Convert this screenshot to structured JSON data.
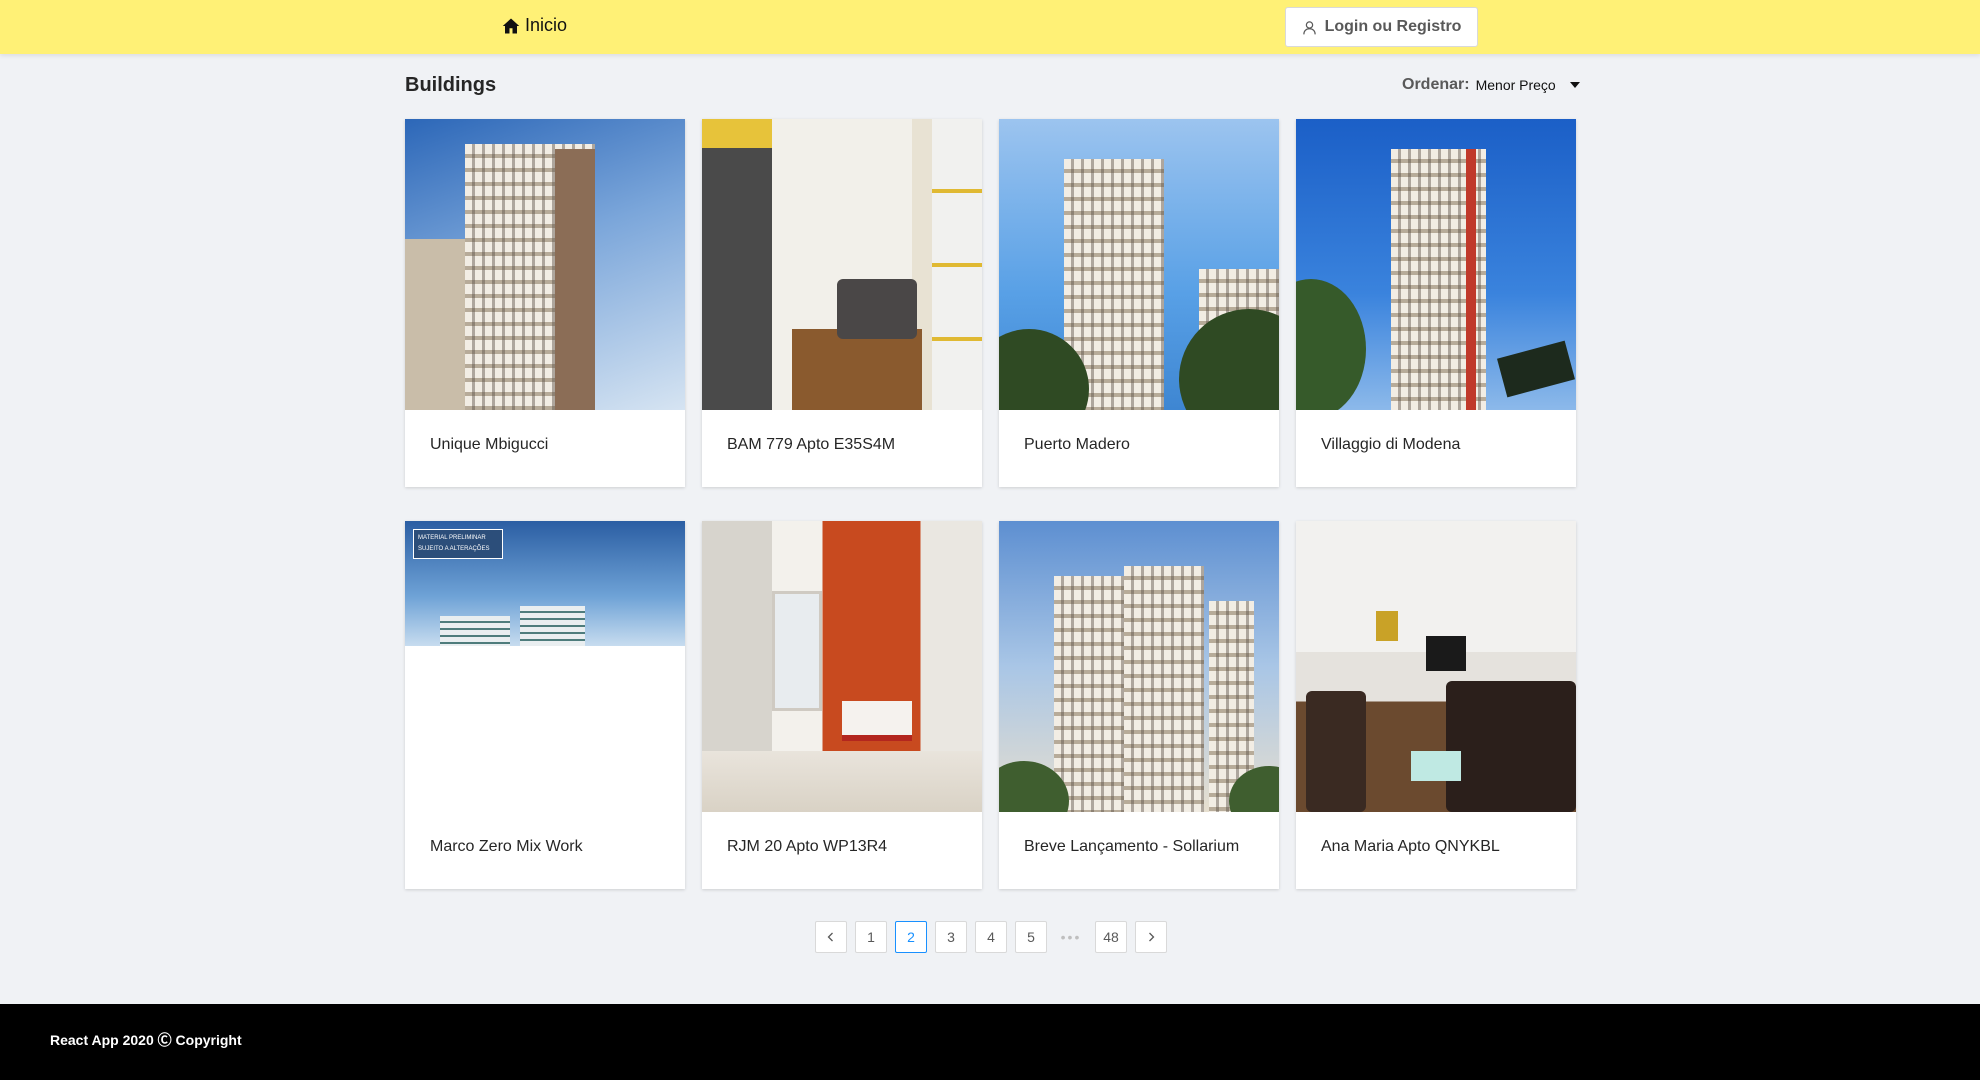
{
  "header": {
    "home_label": "Inicio",
    "login_label": "Login ou Registro"
  },
  "main": {
    "title": "Buildings",
    "sort_label": "Ordenar:",
    "sort_value": "Menor Preço"
  },
  "listings": [
    {
      "title": "Unique Mbigucci"
    },
    {
      "title": "BAM 779 Apto E35S4M"
    },
    {
      "title": "Puerto Madero"
    },
    {
      "title": "Villaggio di Modena"
    },
    {
      "title": "Marco Zero Mix Work",
      "image_tag_line1": "MATERIAL PRELIMINAR",
      "image_tag_line2": "SUJEITO A ALTERAÇÕES"
    },
    {
      "title": "RJM 20 Apto WP13R4"
    },
    {
      "title": "Breve Lançamento - Sollarium"
    },
    {
      "title": "Ana Maria Apto QNYKBL"
    }
  ],
  "pagination": {
    "pages": [
      "1",
      "2",
      "3",
      "4",
      "5",
      "•••",
      "48"
    ],
    "current": "2"
  },
  "footer": {
    "text": "React App 2020 Ⓒ Copyright"
  },
  "colors": {
    "header_bg": "#fff176",
    "page_bg": "#f0f2f5",
    "footer_bg": "#000000",
    "accent": "#1890ff"
  },
  "icons": [
    "home-icon",
    "user-icon",
    "caret-down-icon",
    "chevron-left-icon",
    "chevron-right-icon"
  ]
}
